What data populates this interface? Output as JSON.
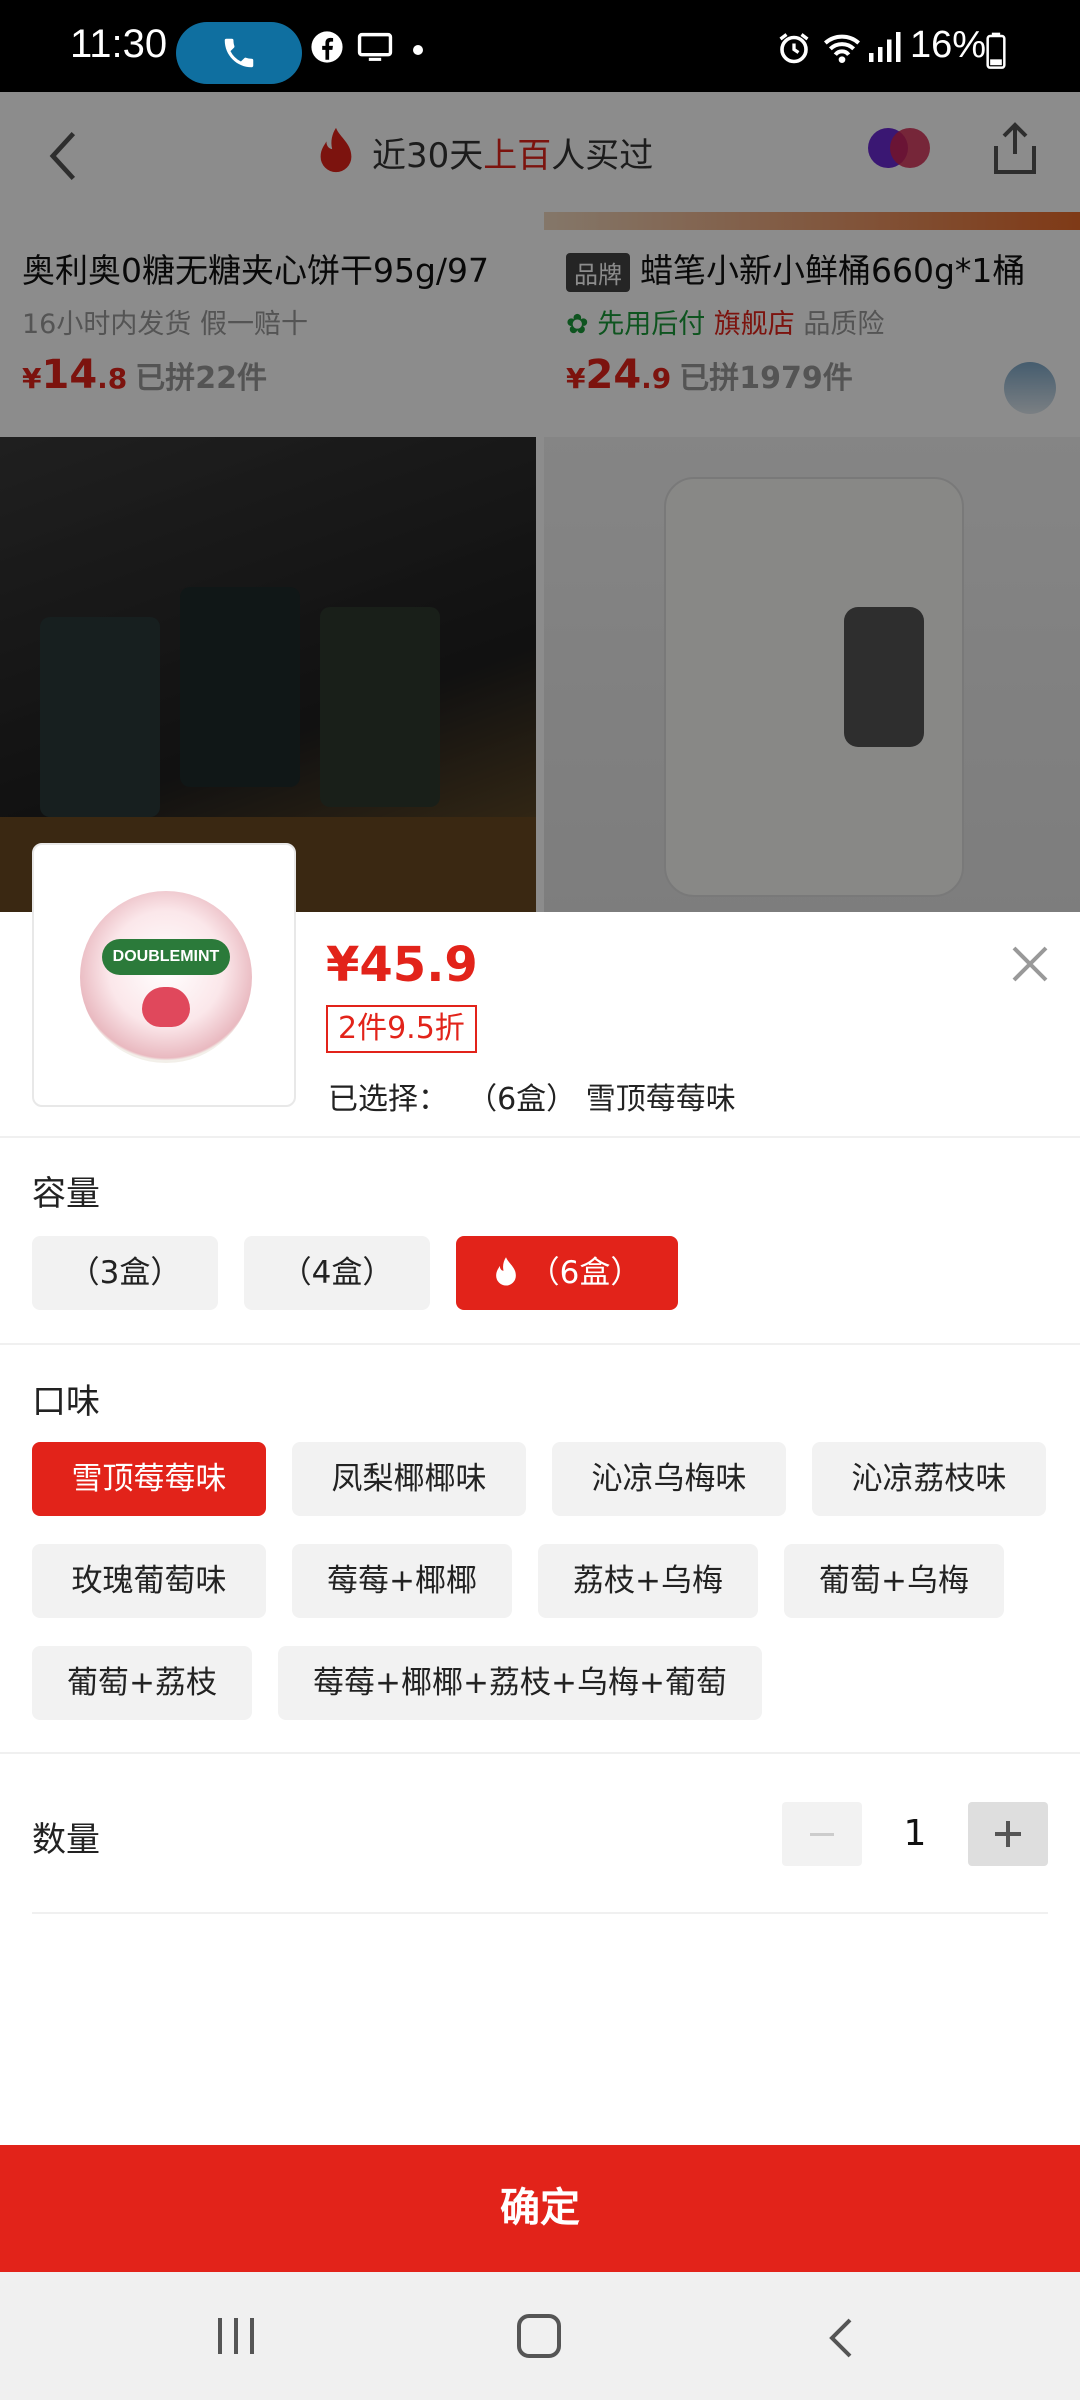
{
  "status_bar": {
    "time": "11:30",
    "battery": "16%",
    "icons": [
      "phone-icon",
      "facebook-icon",
      "screen-cast-icon",
      "dot-icon",
      "alarm-icon",
      "wifi-icon",
      "signal-icon",
      "battery-icon"
    ]
  },
  "background_page": {
    "header": {
      "title_prefix": "近30天",
      "title_highlight": "上百",
      "title_suffix": "人买过"
    },
    "cards": [
      {
        "name": "奥利奥0糖无糖夹心饼干95g/97",
        "sub": "16小时内发货  假一赔十",
        "price_symbol": "¥",
        "price_int": "14",
        "price_dec": ".8",
        "sold": "已拼22件"
      },
      {
        "brand_tag": "品牌",
        "name": "蜡笔小新小鲜桶660g*1桶",
        "sub_green": "先用后付",
        "sub_red": "旗舰店",
        "sub_rest": "品质险",
        "price_symbol": "¥",
        "price_int": "24",
        "price_dec": ".9",
        "sold": "已拼1979件"
      }
    ]
  },
  "product": {
    "price": "¥45.9",
    "discount": "2件9.5折",
    "selected_label": "已选择：",
    "selected_value": "（6盒） 雪顶莓莓味",
    "thumbnail_label": "DOUBLEMINT"
  },
  "capacity": {
    "title": "容量",
    "options": [
      "（3盒）",
      "（4盒）",
      "（6盒）"
    ],
    "selected_index": 2
  },
  "flavor": {
    "title": "口味",
    "options": [
      "雪顶莓莓味",
      "凤梨椰椰味",
      "沁凉乌梅味",
      "沁凉荔枝味",
      "玫瑰葡萄味",
      "莓莓+椰椰",
      "荔枝+乌梅",
      "葡萄+乌梅",
      "葡萄+荔枝",
      "莓莓+椰椰+荔枝+乌梅+葡萄"
    ],
    "selected_index": 0
  },
  "quantity": {
    "title": "数量",
    "value": "1",
    "minus": "−",
    "plus": "+"
  },
  "confirm_label": "确定",
  "colors": {
    "accent": "#e2231a",
    "chip_bg": "#f2f2f2"
  }
}
